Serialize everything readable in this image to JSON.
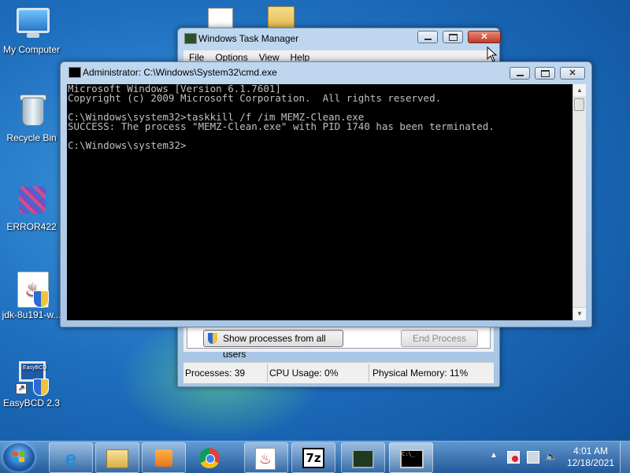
{
  "desktop": {
    "icons": [
      {
        "label": "My Computer"
      },
      {
        "label": "Recycle Bin"
      },
      {
        "label": "ERROR422"
      },
      {
        "label": "jdk-8u191-w..."
      },
      {
        "label": "EasyBCD 2.3"
      }
    ]
  },
  "task_manager": {
    "title": "Windows Task Manager",
    "menu": [
      "File",
      "Options",
      "View",
      "Help"
    ],
    "show_all_button": "Show processes from all users",
    "end_process_button": "End Process",
    "status": {
      "processes": "Processes: 39",
      "cpu": "CPU Usage: 0%",
      "memory": "Physical Memory: 11%"
    }
  },
  "cmd": {
    "title": "Administrator: C:\\Windows\\System32\\cmd.exe",
    "lines": [
      "Microsoft Windows [Version 6.1.7601]",
      "Copyright (c) 2009 Microsoft Corporation.  All rights reserved.",
      "",
      "C:\\Windows\\system32>taskkill /f /im MEMZ-Clean.exe",
      "SUCCESS: The process \"MEMZ-Clean.exe\" with PID 1740 has been terminated.",
      "",
      "C:\\Windows\\system32>"
    ]
  },
  "taskbar": {
    "icon_names": [
      "ie-icon",
      "explorer-icon",
      "media-player-icon",
      "chrome-icon",
      "java-icon",
      "7zip-icon",
      "task-manager-icon",
      "cmd-icon"
    ],
    "app_7zip_label": "7z",
    "clock": {
      "time": "4:01 AM",
      "date": "12/18/2021"
    }
  },
  "colors": {
    "console_bg": "#000000",
    "console_fg": "#c0c0c0",
    "close_button": "#c0392b",
    "desktop_bg": "#1f6fbf"
  }
}
